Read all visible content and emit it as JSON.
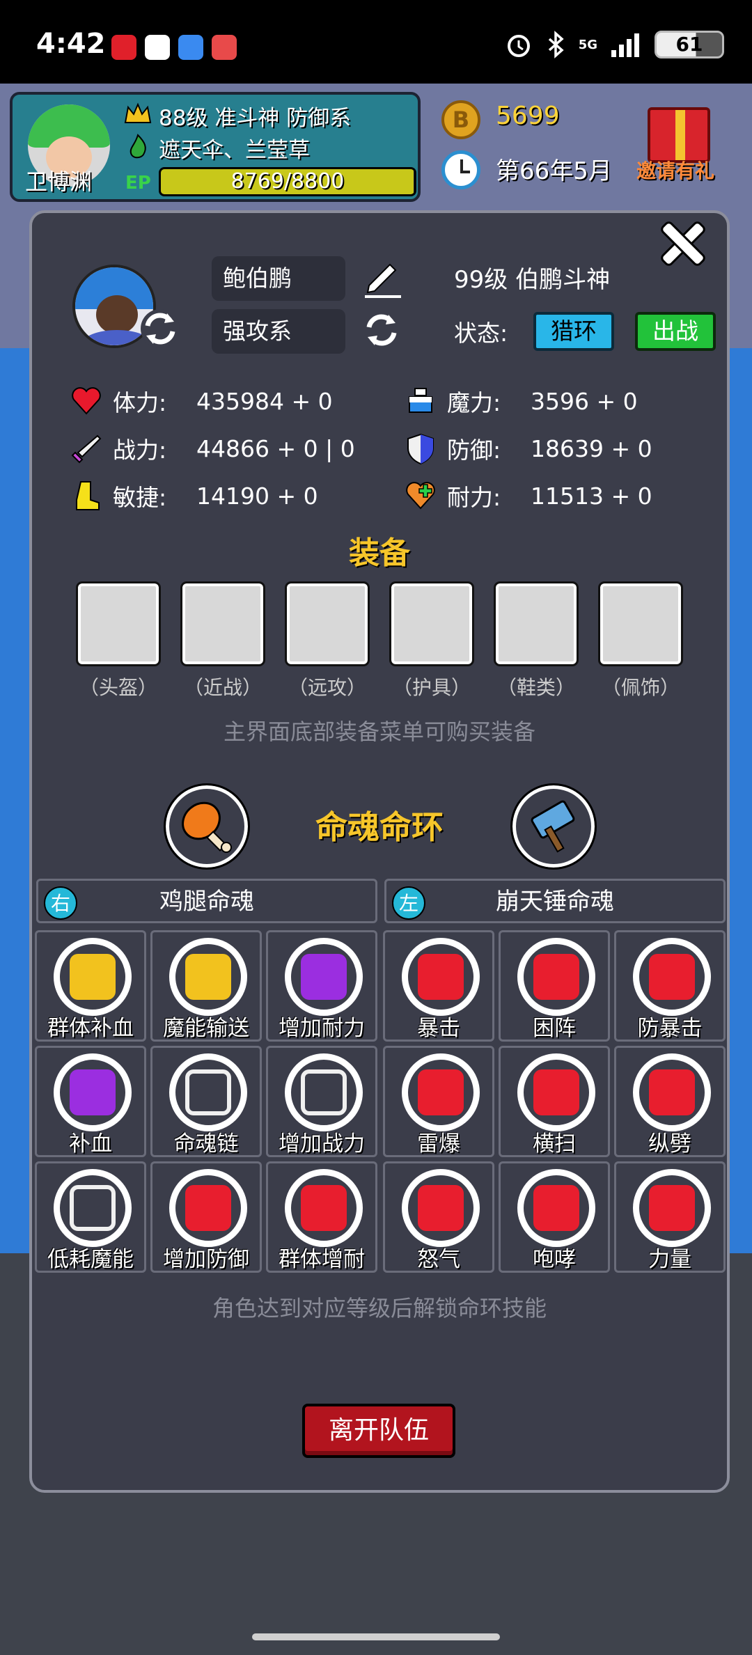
{
  "status_bar": {
    "time": "4:42",
    "battery": "61",
    "network": "5G"
  },
  "player": {
    "name": "卫博渊",
    "title_line": "88级 准斗神 防御系",
    "equip_line": "遮天伞、兰莹草",
    "tag": "EP",
    "xp_text": "8769/8800",
    "xp_fraction": 0.996
  },
  "header": {
    "coins": "5699",
    "game_date": "第66年5月",
    "invite_label": "邀请有礼"
  },
  "modal": {
    "char_name": "鲍伯鹏",
    "char_type": "强攻系",
    "char_title": "99级 伯鹏斗神",
    "state_label": "状态:",
    "state_hunt": "猎环",
    "state_fight": "出战",
    "stats": [
      {
        "icon": "heart-icon",
        "label": "体力:",
        "value": "435984 + 0"
      },
      {
        "icon": "mana-potion-icon",
        "label": "魔力:",
        "value": "3596 + 0"
      },
      {
        "icon": "sword-icon",
        "label": "战力:",
        "value": "44866 + 0 | 0"
      },
      {
        "icon": "shield-icon",
        "label": "防御:",
        "value": "18639 + 0"
      },
      {
        "icon": "boot-icon",
        "label": "敏捷:",
        "value": "14190 + 0"
      },
      {
        "icon": "stamina-heart-icon",
        "label": "耐力:",
        "value": "11513 + 0"
      }
    ],
    "equip_title": "装备",
    "equip_slots": [
      "（头盔）",
      "（近战）",
      "（远攻）",
      "（护具）",
      "（鞋类）",
      "（佩饰）"
    ],
    "equip_hint": "主界面底部装备菜单可购买装备",
    "ring_title": "命魂命环",
    "right_soul": {
      "side": "右",
      "name": "鸡腿命魂"
    },
    "left_soul": {
      "side": "左",
      "name": "崩天锤命魂"
    },
    "skills_right": [
      {
        "label": "群体补血",
        "ring": "yellow"
      },
      {
        "label": "魔能输送",
        "ring": "yellow"
      },
      {
        "label": "增加耐力",
        "ring": "purple"
      },
      {
        "label": "补血",
        "ring": "purple"
      },
      {
        "label": "命魂链",
        "ring": "black"
      },
      {
        "label": "增加战力",
        "ring": "black"
      },
      {
        "label": "低耗魔能",
        "ring": "black"
      },
      {
        "label": "增加防御",
        "ring": "red"
      },
      {
        "label": "群体增耐",
        "ring": "red"
      }
    ],
    "skills_left": [
      {
        "label": "暴击",
        "ring": "red"
      },
      {
        "label": "困阵",
        "ring": "red"
      },
      {
        "label": "防暴击",
        "ring": "red"
      },
      {
        "label": "雷爆",
        "ring": "red"
      },
      {
        "label": "横扫",
        "ring": "red"
      },
      {
        "label": "纵劈",
        "ring": "red"
      },
      {
        "label": "怒气",
        "ring": "red"
      },
      {
        "label": "咆哮",
        "ring": "red"
      },
      {
        "label": "力量",
        "ring": "red"
      }
    ],
    "unlock_hint": "角色达到对应等级后解锁命环技能",
    "leave_button": "离开队伍"
  },
  "colors": {
    "accent_gold": "#f7c62a",
    "ring_yellow": "#f2c21e",
    "ring_purple": "#9b2ee0",
    "ring_black": "#111111",
    "ring_red": "#d8182c",
    "leave_red": "#b2141e",
    "hunt_blue": "#29b6e8",
    "fight_green": "#22c23a"
  }
}
